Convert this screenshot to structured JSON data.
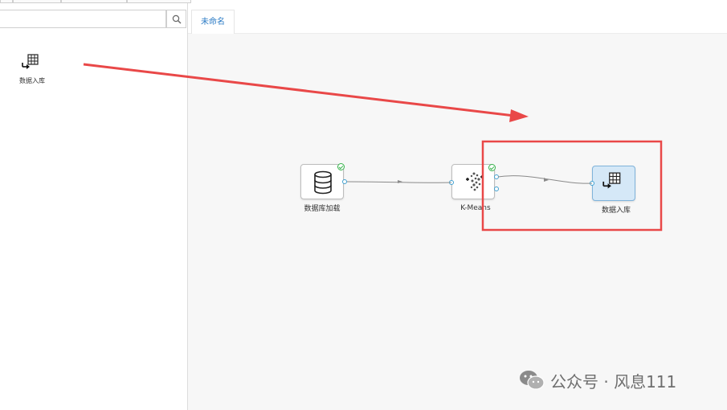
{
  "palette": {
    "search": {
      "value": ""
    },
    "items": [
      {
        "label": "数据入库",
        "icon": "table-import-icon"
      }
    ]
  },
  "tabs": [
    {
      "label": "未命名",
      "active": true
    }
  ],
  "canvas": {
    "nodes": [
      {
        "id": "db-load",
        "label": "数据库加载",
        "icon": "database-icon",
        "status": "success",
        "selected": false
      },
      {
        "id": "kmeans",
        "label": "K-Means",
        "icon": "cluster-icon",
        "status": "success",
        "selected": false
      },
      {
        "id": "db-write",
        "label": "数据入库",
        "icon": "table-import-icon",
        "status": "none",
        "selected": true
      }
    ],
    "edges": [
      [
        "db-load",
        "kmeans"
      ],
      [
        "kmeans",
        "db-write"
      ]
    ]
  },
  "annotation": {
    "arrow_color": "#e94848",
    "box_color": "#e94848"
  },
  "watermark": {
    "text": "公众号 · 风息111"
  },
  "colors": {
    "accent": "#2b7bc5",
    "port": "#3fa0d0",
    "success": "#35b34a",
    "selected_fill": "#d5e8f7"
  }
}
